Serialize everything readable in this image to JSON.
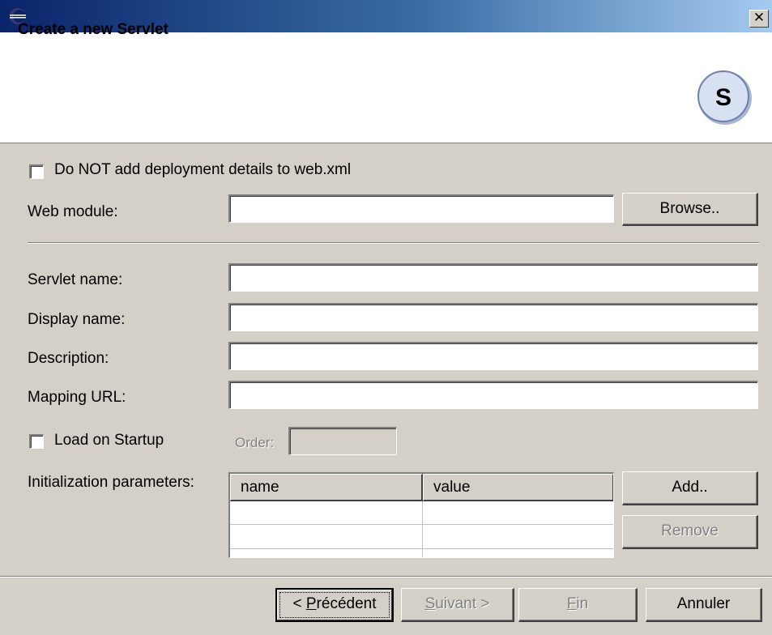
{
  "window": {
    "close_symbol": "✕"
  },
  "banner": {
    "title": "Create a new Servlet",
    "logo_letter": "S"
  },
  "form": {
    "no_deploy_checkbox_label": "Do NOT add deployment details to web.xml",
    "no_deploy_checked": false,
    "web_module_label": "Web module:",
    "web_module_value": "",
    "browse_button": "Browse..",
    "servlet_name_label": "Servlet name:",
    "servlet_name_value": "",
    "display_name_label": "Display name:",
    "display_name_value": "",
    "description_label": "Description:",
    "description_value": "",
    "mapping_url_label": "Mapping URL:",
    "mapping_url_value": "",
    "load_on_startup_label": "Load on Startup",
    "load_on_startup_checked": false,
    "order_label": "Order:",
    "order_value": "",
    "init_params_label": "Initialization parameters:",
    "init_params_columns": [
      "name",
      "value"
    ],
    "add_button": "Add..",
    "remove_button": "Remove"
  },
  "footer": {
    "back_prefix": "< ",
    "back_mnemonic": "P",
    "back_rest": "récédent",
    "next_mnemonic": "S",
    "next_rest": "uivant >",
    "finish_mnemonic": "F",
    "finish_rest": "in",
    "cancel": "Annuler"
  },
  "colors": {
    "dialog_bg": "#d4d0c8",
    "titlebar_start": "#0a246a",
    "titlebar_end": "#a6caf0",
    "logo_fill": "#c8d3e8"
  }
}
